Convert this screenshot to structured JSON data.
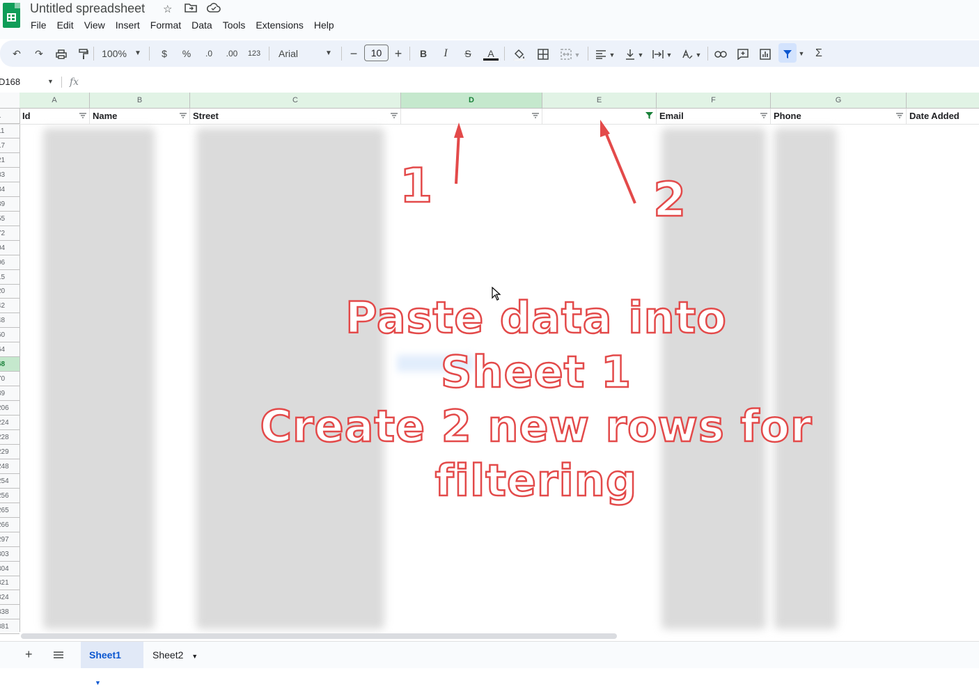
{
  "app": {
    "title": "Untitled spreadsheet",
    "icons": [
      "star-icon",
      "move-folder-icon",
      "cloud-saved-icon"
    ]
  },
  "menu": [
    "File",
    "Edit",
    "View",
    "Insert",
    "Format",
    "Data",
    "Tools",
    "Extensions",
    "Help"
  ],
  "toolbar": {
    "zoom": "100%",
    "currency": "$",
    "percent": "%",
    "decrease_decimal": ".0",
    "increase_decimal": ".00",
    "number_format": "123",
    "font": "Arial",
    "font_size": "10",
    "minus": "−",
    "plus": "+",
    "bold": "B",
    "italic": "I",
    "strike": "S",
    "text_color": "A",
    "sum": "Σ"
  },
  "formula_bar": {
    "name_box": "D168",
    "fx": "fx"
  },
  "columns": [
    "A",
    "B",
    "C",
    "D",
    "E",
    "F",
    "G"
  ],
  "header_row_number": "1",
  "headers": [
    "Id",
    "Name",
    "Street",
    "",
    "",
    "Email",
    "Phone",
    "Date Added"
  ],
  "row_numbers": [
    "11",
    "17",
    "21",
    "33",
    "34",
    "39",
    "55",
    "72",
    "04",
    "06",
    "15",
    "20",
    "42",
    "48",
    "60",
    "64",
    "68",
    "70",
    "89",
    "206",
    "224",
    "228",
    "229",
    "248",
    "254",
    "256",
    "265",
    "266",
    "297",
    "303",
    "304",
    "321",
    "324",
    "338",
    "381"
  ],
  "selected_row_index": 16,
  "annotations": {
    "label_1": "1",
    "label_2": "2",
    "line1": "Paste data into",
    "line2": "Sheet 1",
    "line3": "Create 2 new rows for filtering"
  },
  "sheets": [
    {
      "name": "Sheet1",
      "active": true
    },
    {
      "name": "Sheet2",
      "active": false
    }
  ],
  "colors": {
    "accent": "#0b57d0",
    "annotation": "#e34a4a",
    "green": "#188038"
  }
}
